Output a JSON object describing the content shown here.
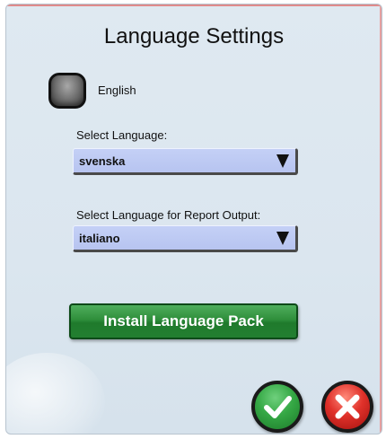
{
  "dialog": {
    "title": "Language Settings"
  },
  "english_option": {
    "label": "English",
    "selected": false
  },
  "ui_language": {
    "label": "Select Language:",
    "value": "svenska"
  },
  "report_language": {
    "label": "Select Language for Report Output:",
    "value": "italiano"
  },
  "install_button": {
    "label": "Install Language Pack"
  },
  "actions": {
    "ok_icon": "checkmark-icon",
    "cancel_icon": "x-icon"
  },
  "colors": {
    "background": "#dbe6ef",
    "select_fill": "#bcc8f2",
    "install_green": "#2e8e3b",
    "ok_green": "#35a845",
    "cancel_red": "#e0312a"
  }
}
